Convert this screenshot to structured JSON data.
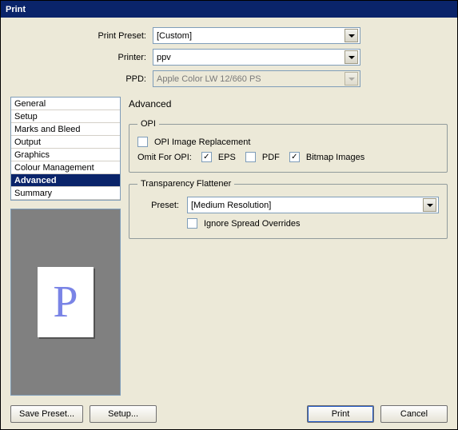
{
  "window": {
    "title": "Print"
  },
  "top": {
    "print_preset_label": "Print Preset:",
    "print_preset_value": "[Custom]",
    "printer_label": "Printer:",
    "printer_value": "ppv",
    "ppd_label": "PPD:",
    "ppd_value": "Apple Color LW 12/660 PS"
  },
  "sidebar": {
    "items": [
      {
        "label": "General"
      },
      {
        "label": "Setup"
      },
      {
        "label": "Marks and Bleed"
      },
      {
        "label": "Output"
      },
      {
        "label": "Graphics"
      },
      {
        "label": "Colour Management"
      },
      {
        "label": "Advanced",
        "selected": true
      },
      {
        "label": "Summary"
      }
    ]
  },
  "preview": {
    "glyph": "P"
  },
  "advanced": {
    "heading": "Advanced",
    "opi": {
      "legend": "OPI",
      "replacement_label": "OPI Image Replacement",
      "replacement_checked": false,
      "omit_label": "Omit For OPI:",
      "eps_label": "EPS",
      "eps_checked": true,
      "pdf_label": "PDF",
      "pdf_checked": false,
      "bitmap_label": "Bitmap Images",
      "bitmap_checked": true
    },
    "tf": {
      "legend": "Transparency Flattener",
      "preset_label": "Preset:",
      "preset_value": "[Medium Resolution]",
      "ignore_label": "Ignore Spread Overrides",
      "ignore_checked": false
    }
  },
  "buttons": {
    "save_preset": "Save Preset...",
    "setup": "Setup...",
    "print": "Print",
    "cancel": "Cancel"
  }
}
